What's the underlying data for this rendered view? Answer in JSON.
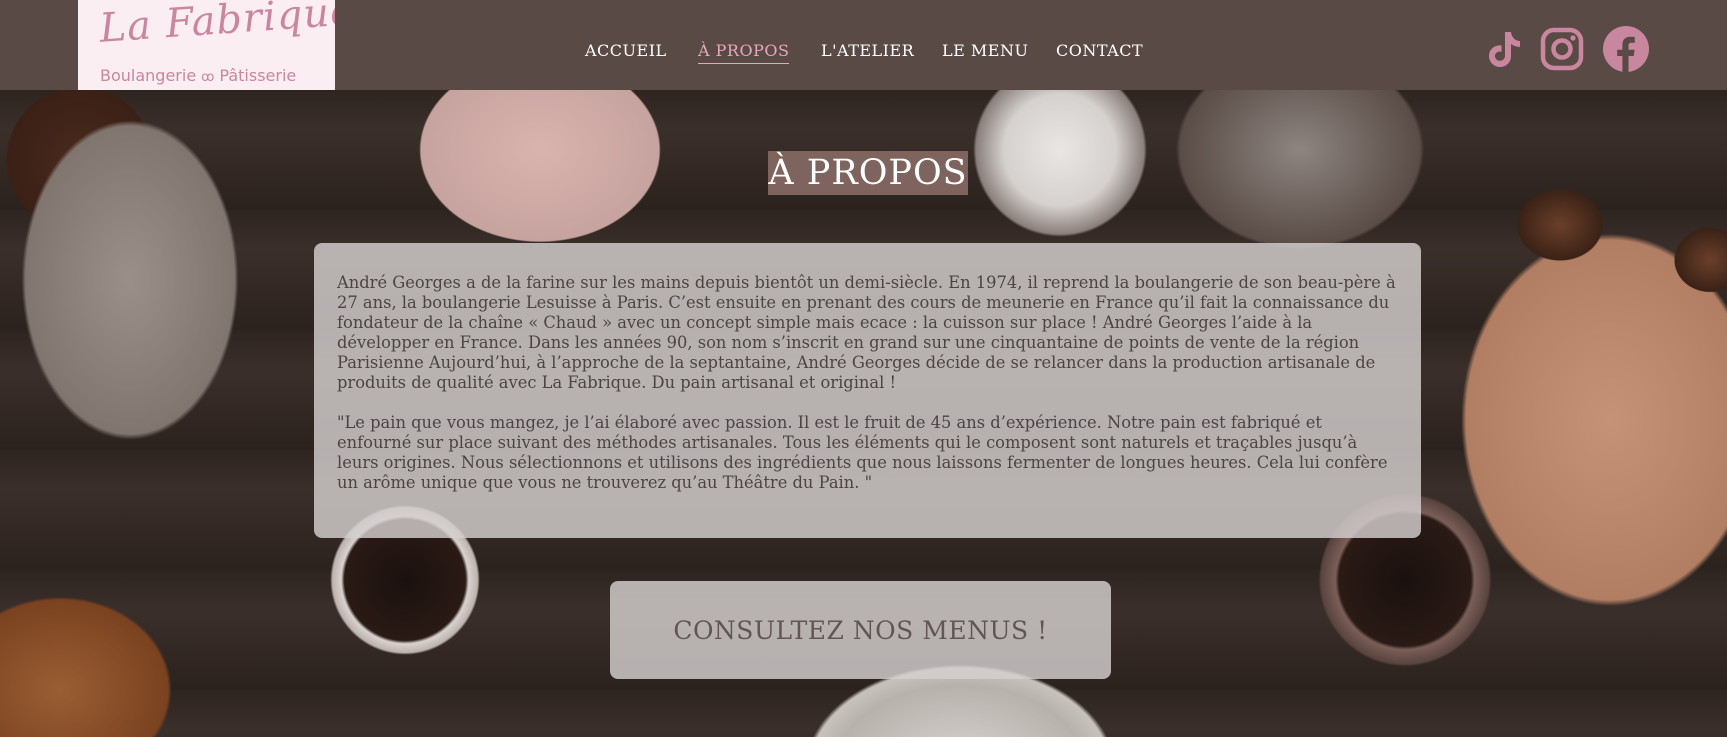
{
  "brand": {
    "logo_script": "La Fabrique",
    "logo_left": "Boulangerie",
    "logo_swirl": "ꝏ",
    "logo_right": "Pâtisserie"
  },
  "nav": {
    "items": [
      {
        "label": "ACCUEIL",
        "active": false
      },
      {
        "label": "À PROPOS",
        "active": true
      },
      {
        "label": "L'ATELIER",
        "active": false
      },
      {
        "label": "LE MENU",
        "active": false
      },
      {
        "label": "CONTACT",
        "active": false
      }
    ]
  },
  "social": {
    "icons": [
      "tiktok-icon",
      "instagram-icon",
      "facebook-icon"
    ],
    "color": "#c9869f"
  },
  "main": {
    "title": "À PROPOS",
    "paragraph_1": "André Georges a de la farine sur les mains depuis bientôt un demi-siècle. En 1974, il reprend la boulangerie de son beau-père à 27 ans, la boulangerie Lesuisse à Paris. C’est ensuite en prenant des cours de meunerie en France qu’il fait la connaissance du fondateur de la chaîne « Chaud » avec un concept simple mais ecace : la cuisson sur place ! André Georges l’aide à la développer en France. Dans les années 90, son nom s’inscrit en grand sur une cinquantaine de points de vente de la région Parisienne Aujourd’hui, à l’approche de la septantaine, André Georges décide de se relancer dans la production artisanale de produits de qualité avec La Fabrique. Du pain artisanal et original !",
    "paragraph_2": "\"Le pain que vous mangez, je l’ai élaboré avec passion. Il est le fruit de 45 ans d’expérience. Notre pain est fabriqué et enfourné sur place suivant des méthodes artisanales. Tous les éléments qui le composent sont naturels et traçables jusqu’à leurs origines. Nous sélectionnons et utilisons des ingrédients que nous laissons fermenter de longues heures. Cela lui confère un arôme unique que vous ne trouverez qu’au Théâtre du Pain. \"",
    "cta_label": "CONSULTEZ NOS MENUS !"
  },
  "colors": {
    "header_bg": "#5a4a45",
    "accent_pink": "#e8a7bf",
    "panel_bg": "#d4d0cf"
  }
}
